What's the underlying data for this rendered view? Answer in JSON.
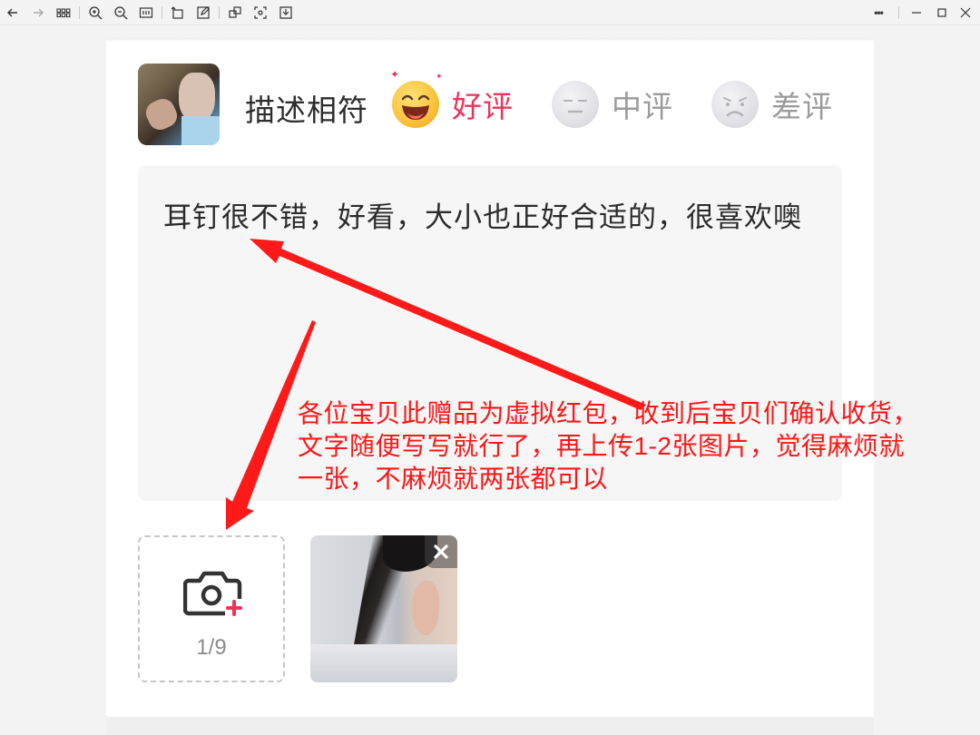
{
  "viewer": {
    "toolbar_icons": [
      "back-icon",
      "forward-icon",
      "grid-icon",
      "zoom-in-icon",
      "zoom-out-icon",
      "fit-icon",
      "rotate-icon",
      "edit-icon",
      "copy-icon",
      "fullscreen-icon",
      "save-icon"
    ],
    "window_controls": [
      "more-icon",
      "pin-icon",
      "minimize-icon",
      "maximize-icon",
      "close-icon"
    ],
    "more_label": "•••"
  },
  "review": {
    "description_label": "描述相符",
    "ratings": [
      {
        "label": "好评",
        "selected": true,
        "color": "#f0325a"
      },
      {
        "label": "中评",
        "selected": false,
        "color": "#9b9b9b"
      },
      {
        "label": "差评",
        "selected": false,
        "color": "#9b9b9b"
      }
    ],
    "comment": "耳钉很不错，好看，大小也正好合适的，很喜欢噢",
    "upload": {
      "count": "1/9"
    }
  },
  "annotation": {
    "text": "各位宝贝此赠品为虚拟红包，收到后宝贝们确认收货，文字随便写写就行了，再上传1-2张图片，觉得麻烦就一张，不麻烦就两张都可以",
    "color": "#ff1515"
  }
}
